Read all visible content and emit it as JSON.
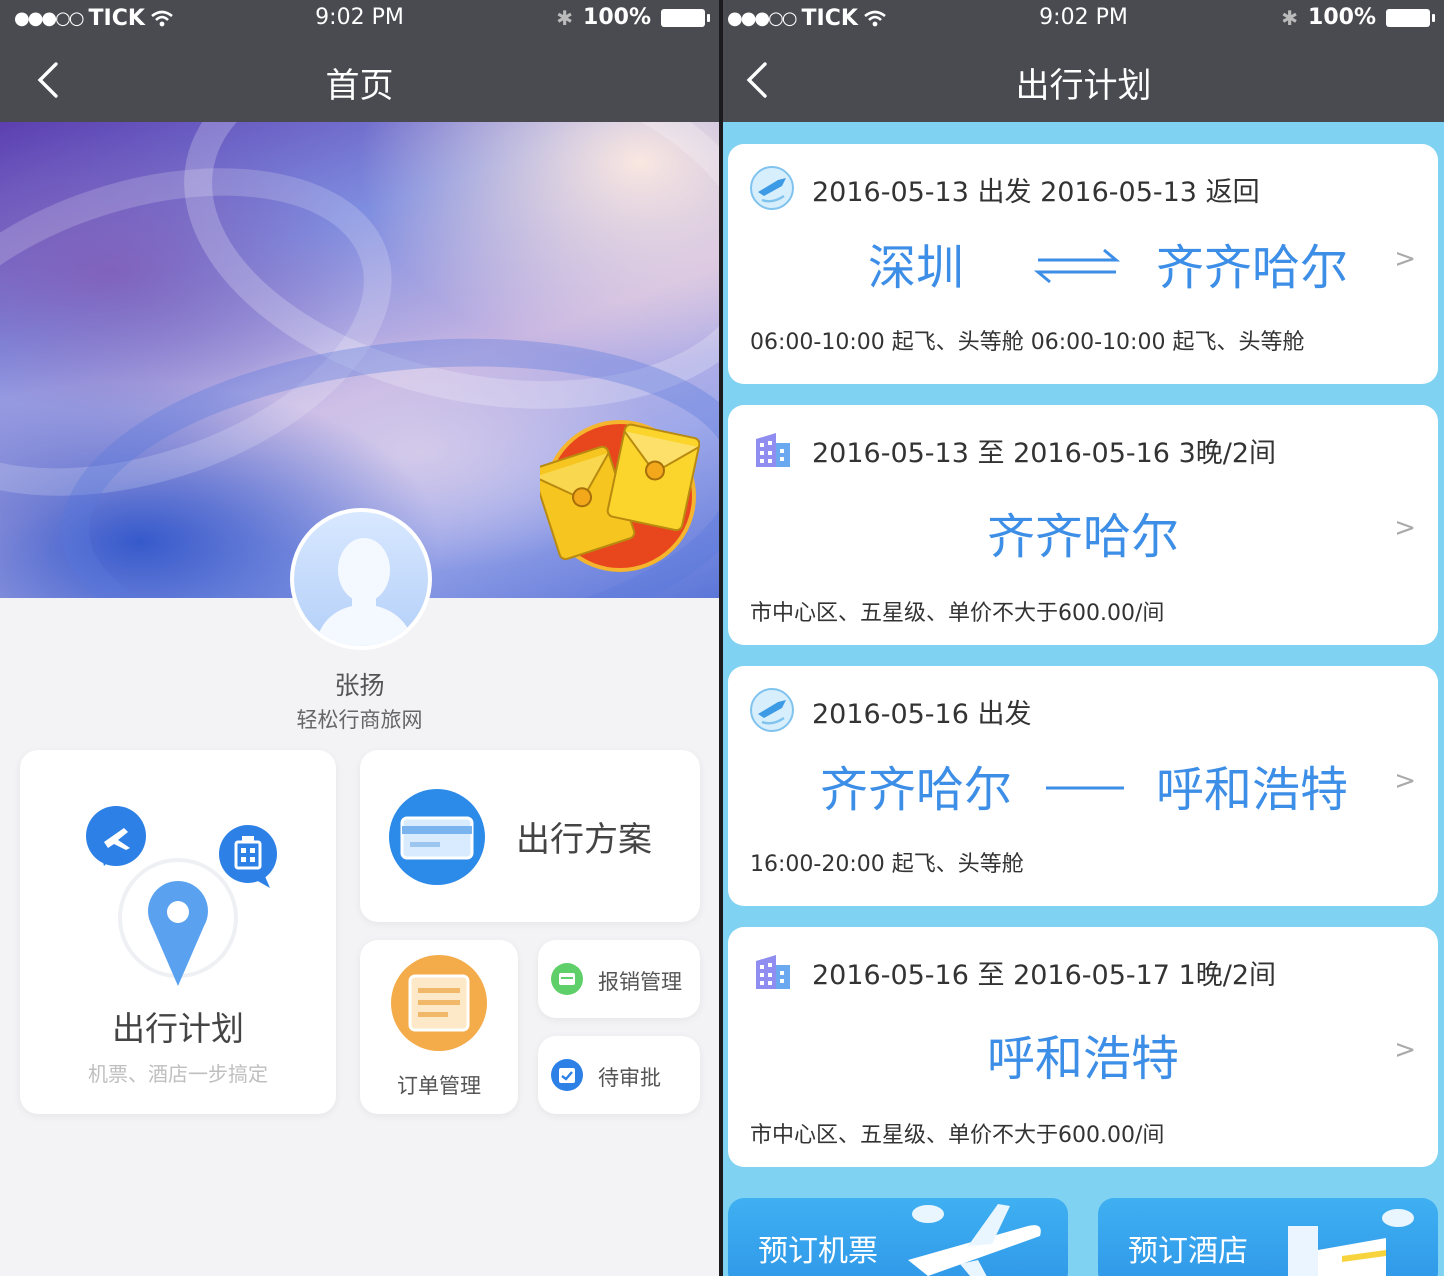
{
  "left": {
    "status": {
      "carrier": "TICK",
      "time": "9:02 PM",
      "battery": "100%"
    },
    "nav": {
      "title": "首页"
    },
    "user": {
      "name": "张扬",
      "company": "轻松行商旅网"
    },
    "tiles": {
      "plan": {
        "title": "出行计划",
        "subtitle": "机票、酒店一步搞定"
      },
      "scheme": {
        "label": "出行方案"
      },
      "orders": {
        "label": "订单管理"
      },
      "expense": {
        "label": "报销管理"
      },
      "approval": {
        "label": "待审批"
      }
    }
  },
  "right": {
    "status": {
      "carrier": "TICK",
      "time": "9:02 PM",
      "battery": "100%"
    },
    "nav": {
      "title": "出行计划"
    },
    "trips": [
      {
        "type": "flight",
        "icon": "plane-icon",
        "header": "2016-05-13 出发  2016-05-13 返回",
        "from": "深圳",
        "to": "齐齐哈尔",
        "connector": "round-trip",
        "footer": "06:00-10:00 起飞、头等舱   06:00-10:00 起飞、头等舱"
      },
      {
        "type": "hotel",
        "icon": "hotel-icon",
        "header": "2016-05-13 至 2016-05-16   3晚/2间",
        "city": "齐齐哈尔",
        "footer": "市中心区、五星级、单价不大于600.00/间"
      },
      {
        "type": "flight",
        "icon": "plane-icon",
        "header": "2016-05-16 出发",
        "from": "齐齐哈尔",
        "to": "呼和浩特",
        "connector": "one-way",
        "footer": "16:00-20:00 起飞、头等舱"
      },
      {
        "type": "hotel",
        "icon": "hotel-icon",
        "header": "2016-05-16 至 2016-05-17   1晚/2间",
        "city": "呼和浩特",
        "footer": "市中心区、五星级、单价不大于600.00/间"
      }
    ],
    "chevron": ">",
    "buttons": {
      "book_flight": "预订机票",
      "book_hotel": "预订酒店"
    }
  },
  "colors": {
    "nav": "#4a4a51",
    "accent": "#3d8ee6",
    "right_bg": "#7fd2f1",
    "button": "#3fb0f2"
  }
}
